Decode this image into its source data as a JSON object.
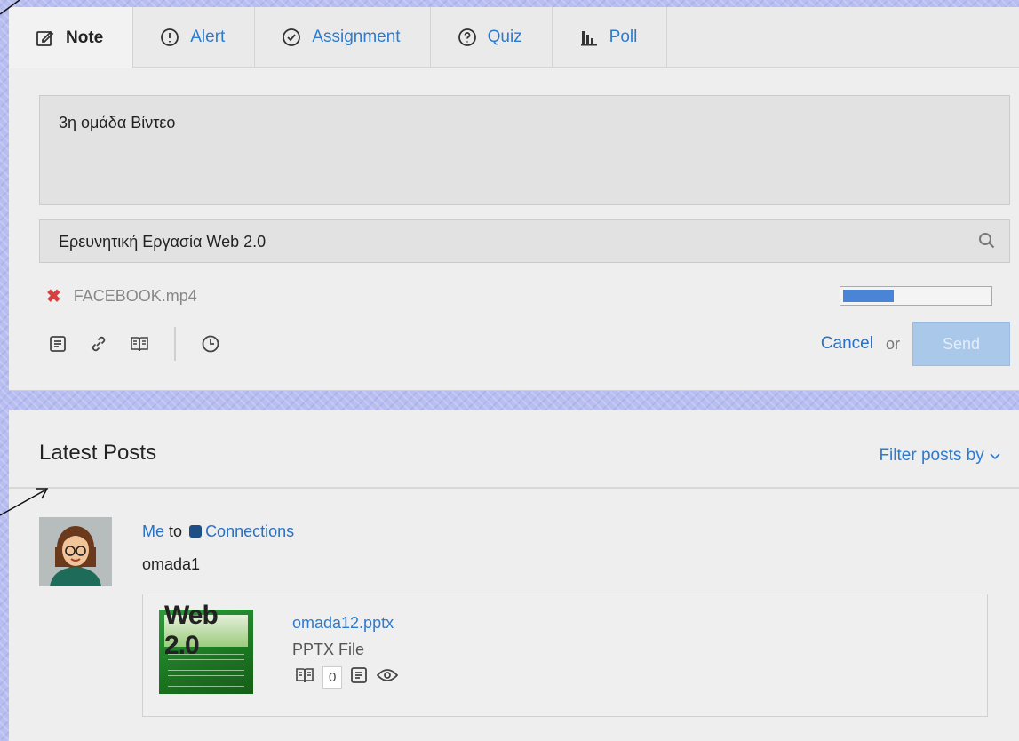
{
  "tabs": [
    {
      "label": "Note",
      "icon": "edit-note-icon"
    },
    {
      "label": "Alert",
      "icon": "alert-icon"
    },
    {
      "label": "Assignment",
      "icon": "check-circle-icon"
    },
    {
      "label": "Quiz",
      "icon": "question-circle-icon"
    },
    {
      "label": "Poll",
      "icon": "bar-chart-icon"
    }
  ],
  "composer": {
    "note_text": "3η ομάδα Βίντεο",
    "group_value": "Ερευνητική Εργασία Web 2.0",
    "attachment_name": "FACEBOOK.mp4",
    "upload_progress": 0.35,
    "cancel_label": "Cancel",
    "or_label": "or",
    "send_label": "Send"
  },
  "posts": {
    "title": "Latest Posts",
    "filter_label": "Filter posts by",
    "items": [
      {
        "author": "Me",
        "to": "to",
        "group": "Connections",
        "text": "omada1",
        "attachment": {
          "thumb_text": "Web 2.0",
          "file_name": "omada12.pptx",
          "file_type": "PPTX File",
          "library_count": "0"
        }
      }
    ]
  },
  "colors": {
    "accent": "#2c7bd0",
    "send_disabled": "#a9c8ea",
    "panel": "#eeeeee"
  }
}
